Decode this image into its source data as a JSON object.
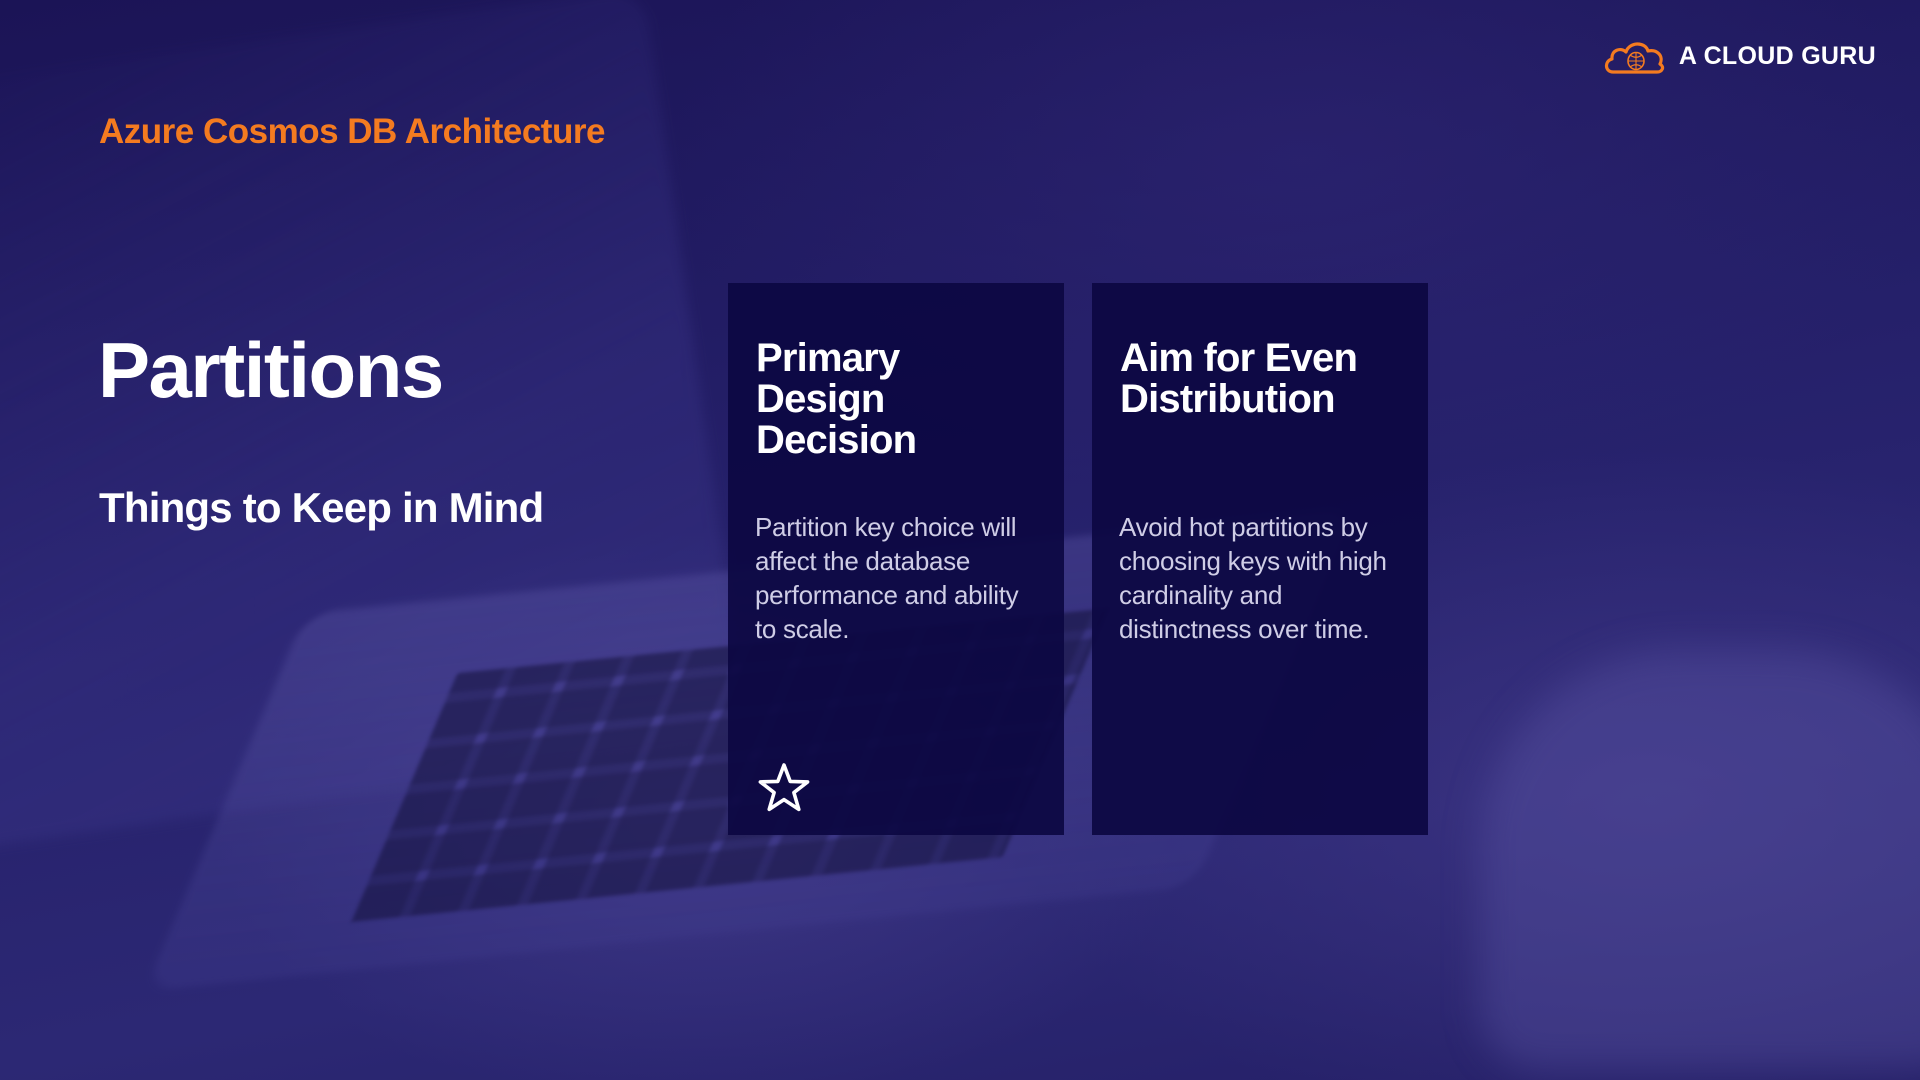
{
  "header": {
    "course_title": "Azure Cosmos DB Architecture",
    "logo": {
      "icon": "cloud-icon",
      "text": "A CLOUD GURU",
      "icon_color": "#f47b20"
    }
  },
  "main": {
    "title": "Partitions",
    "subtitle": "Things to Keep in Mind"
  },
  "cards": [
    {
      "title": "Primary Design Decision",
      "body": "Partition key choice will affect the database performance and ability to scale.",
      "icon": "star-icon"
    },
    {
      "title": "Aim for Even Distribution",
      "body": "Avoid hot partitions by choosing keys with high cardinality and distinctness over time."
    }
  ],
  "colors": {
    "accent": "#f47b20",
    "background": "#241f66",
    "card": "#0c0842",
    "text": "#ffffff",
    "body_text": "#cfcde6"
  }
}
